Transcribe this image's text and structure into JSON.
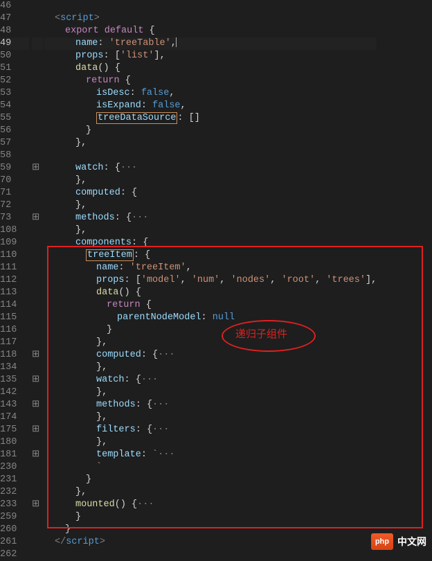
{
  "annotation": {
    "label": "递归子组件"
  },
  "watermark": {
    "badge": "php",
    "text": "中文网"
  },
  "lines": [
    {
      "n": "46",
      "f": "",
      "html": "<span class='ind'></span>"
    },
    {
      "n": "47",
      "f": "",
      "html": "<span class='ind'></span><span class='tag'>&lt;</span><span class='kw'>script</span><span class='tag'>&gt;</span>"
    },
    {
      "n": "48",
      "f": "",
      "html": "<span class='ind'></span><span class='ind'></span><span class='exp'>export</span> <span class='exp'>default</span> <span class='brc'>{</span>"
    },
    {
      "n": "49",
      "f": "",
      "cur": true,
      "html": "<span class='ind'></span><span class='ind'></span><span class='ind'></span><span class='prop'>name</span><span class='punc'>:</span> <span class='str'>'treeTable'</span><span class='punc'>,</span><span class='cursor-mark'></span>"
    },
    {
      "n": "50",
      "f": "",
      "html": "<span class='ind'></span><span class='ind'></span><span class='ind'></span><span class='prop'>props</span><span class='punc'>:</span> <span class='punc'>[</span><span class='str'>'list'</span><span class='punc'>]</span><span class='punc'>,</span>"
    },
    {
      "n": "51",
      "f": "",
      "html": "<span class='ind'></span><span class='ind'></span><span class='ind'></span><span class='fn'>data</span><span class='punc'>()</span> <span class='brc'>{</span>"
    },
    {
      "n": "52",
      "f": "",
      "html": "<span class='ind'></span><span class='ind'></span><span class='ind'></span><span class='ind'></span><span class='exp'>return</span> <span class='brc'>{</span>"
    },
    {
      "n": "53",
      "f": "",
      "html": "<span class='ind'></span><span class='ind'></span><span class='ind'></span><span class='ind'></span><span class='ind'></span><span class='prop'>isDesc</span><span class='punc'>:</span> <span class='bool'>false</span><span class='punc'>,</span>"
    },
    {
      "n": "54",
      "f": "",
      "html": "<span class='ind'></span><span class='ind'></span><span class='ind'></span><span class='ind'></span><span class='ind'></span><span class='prop'>isExpand</span><span class='punc'>:</span> <span class='bool'>false</span><span class='punc'>,</span>"
    },
    {
      "n": "55",
      "f": "",
      "html": "<span class='ind'></span><span class='ind'></span><span class='ind'></span><span class='ind'></span><span class='ind'></span><span class='underline-box'><span class='prop'>treeDataSource</span></span><span class='punc'>:</span> <span class='punc'>[]</span>"
    },
    {
      "n": "56",
      "f": "",
      "html": "<span class='ind'></span><span class='ind'></span><span class='ind'></span><span class='ind'></span><span class='brc'>}</span>"
    },
    {
      "n": "57",
      "f": "",
      "html": "<span class='ind'></span><span class='ind'></span><span class='ind'></span><span class='brc'>}</span><span class='punc'>,</span>"
    },
    {
      "n": "58",
      "f": "",
      "html": "<span class='ind'></span>"
    },
    {
      "n": "59",
      "f": "⊞",
      "html": "<span class='ind'></span><span class='ind'></span><span class='ind'></span><span class='prop'>watch</span><span class='punc'>:</span> <span class='brc'>{</span><span class='ellips'>···</span>"
    },
    {
      "n": "70",
      "f": "",
      "html": "<span class='ind'></span><span class='ind'></span><span class='ind'></span><span class='brc'>}</span><span class='punc'>,</span>"
    },
    {
      "n": "71",
      "f": "",
      "html": "<span class='ind'></span><span class='ind'></span><span class='ind'></span><span class='prop'>computed</span><span class='punc'>:</span> <span class='brc'>{</span>"
    },
    {
      "n": "72",
      "f": "",
      "html": "<span class='ind'></span><span class='ind'></span><span class='ind'></span><span class='brc'>}</span><span class='punc'>,</span>"
    },
    {
      "n": "73",
      "f": "⊞",
      "html": "<span class='ind'></span><span class='ind'></span><span class='ind'></span><span class='prop'>methods</span><span class='punc'>:</span> <span class='brc'>{</span><span class='ellips'>···</span>"
    },
    {
      "n": "108",
      "f": "",
      "html": "<span class='ind'></span><span class='ind'></span><span class='ind'></span><span class='brc'>}</span><span class='punc'>,</span>"
    },
    {
      "n": "109",
      "f": "",
      "html": "<span class='ind'></span><span class='ind'></span><span class='ind'></span><span class='prop'>components</span><span class='punc'>:</span> <span class='brc'>{</span>"
    },
    {
      "n": "110",
      "f": "",
      "html": "<span class='ind'></span><span class='ind'></span><span class='ind'></span><span class='ind'></span><span class='underline-box'><span class='prop'>treeItem</span></span><span class='punc'>:</span> <span class='brc'>{</span>"
    },
    {
      "n": "111",
      "f": "",
      "html": "<span class='ind'></span><span class='ind'></span><span class='ind'></span><span class='ind'></span><span class='ind'></span><span class='prop'>name</span><span class='punc'>:</span> <span class='str'>'treeItem'</span><span class='punc'>,</span>"
    },
    {
      "n": "112",
      "f": "",
      "html": "<span class='ind'></span><span class='ind'></span><span class='ind'></span><span class='ind'></span><span class='ind'></span><span class='prop'>props</span><span class='punc'>:</span> <span class='punc'>[</span><span class='str'>'model'</span><span class='punc'>,</span> <span class='str'>'num'</span><span class='punc'>,</span> <span class='str'>'nodes'</span><span class='punc'>,</span> <span class='str'>'root'</span><span class='punc'>,</span> <span class='str'>'trees'</span><span class='punc'>]</span><span class='punc'>,</span>"
    },
    {
      "n": "113",
      "f": "",
      "html": "<span class='ind'></span><span class='ind'></span><span class='ind'></span><span class='ind'></span><span class='ind'></span><span class='fn'>data</span><span class='punc'>()</span> <span class='brc'>{</span>"
    },
    {
      "n": "114",
      "f": "",
      "html": "<span class='ind'></span><span class='ind'></span><span class='ind'></span><span class='ind'></span><span class='ind'></span><span class='ind'></span><span class='exp'>return</span> <span class='brc'>{</span>"
    },
    {
      "n": "115",
      "f": "",
      "html": "<span class='ind'></span><span class='ind'></span><span class='ind'></span><span class='ind'></span><span class='ind'></span><span class='ind'></span><span class='ind'></span><span class='prop'>parentNodeModel</span><span class='punc'>:</span> <span class='bool'>null</span>"
    },
    {
      "n": "116",
      "f": "",
      "html": "<span class='ind'></span><span class='ind'></span><span class='ind'></span><span class='ind'></span><span class='ind'></span><span class='ind'></span><span class='brc'>}</span>"
    },
    {
      "n": "117",
      "f": "",
      "html": "<span class='ind'></span><span class='ind'></span><span class='ind'></span><span class='ind'></span><span class='ind'></span><span class='brc'>}</span><span class='punc'>,</span>"
    },
    {
      "n": "118",
      "f": "⊞",
      "html": "<span class='ind'></span><span class='ind'></span><span class='ind'></span><span class='ind'></span><span class='ind'></span><span class='prop'>computed</span><span class='punc'>:</span> <span class='brc'>{</span><span class='ellips'>···</span>"
    },
    {
      "n": "134",
      "f": "",
      "html": "<span class='ind'></span><span class='ind'></span><span class='ind'></span><span class='ind'></span><span class='ind'></span><span class='brc'>}</span><span class='punc'>,</span>"
    },
    {
      "n": "135",
      "f": "⊞",
      "html": "<span class='ind'></span><span class='ind'></span><span class='ind'></span><span class='ind'></span><span class='ind'></span><span class='prop'>watch</span><span class='punc'>:</span> <span class='brc'>{</span><span class='ellips'>···</span>"
    },
    {
      "n": "142",
      "f": "",
      "html": "<span class='ind'></span><span class='ind'></span><span class='ind'></span><span class='ind'></span><span class='ind'></span><span class='brc'>}</span><span class='punc'>,</span>"
    },
    {
      "n": "143",
      "f": "⊞",
      "html": "<span class='ind'></span><span class='ind'></span><span class='ind'></span><span class='ind'></span><span class='ind'></span><span class='prop'>methods</span><span class='punc'>:</span> <span class='brc'>{</span><span class='ellips'>···</span>"
    },
    {
      "n": "174",
      "f": "",
      "html": "<span class='ind'></span><span class='ind'></span><span class='ind'></span><span class='ind'></span><span class='ind'></span><span class='brc'>}</span><span class='punc'>,</span>"
    },
    {
      "n": "175",
      "f": "⊞",
      "html": "<span class='ind'></span><span class='ind'></span><span class='ind'></span><span class='ind'></span><span class='ind'></span><span class='prop'>filters</span><span class='punc'>:</span> <span class='brc'>{</span><span class='ellips'>···</span>"
    },
    {
      "n": "180",
      "f": "",
      "html": "<span class='ind'></span><span class='ind'></span><span class='ind'></span><span class='ind'></span><span class='ind'></span><span class='brc'>}</span><span class='punc'>,</span>"
    },
    {
      "n": "181",
      "f": "⊞",
      "html": "<span class='ind'></span><span class='ind'></span><span class='ind'></span><span class='ind'></span><span class='ind'></span><span class='prop'>template</span><span class='punc'>:</span> <span class='str'>`</span><span class='ellips'>···</span>"
    },
    {
      "n": "230",
      "f": "",
      "html": "<span class='ind'></span><span class='ind'></span><span class='ind'></span><span class='ind'></span><span class='ind'></span><span class='str'>`</span>"
    },
    {
      "n": "231",
      "f": "",
      "html": "<span class='ind'></span><span class='ind'></span><span class='ind'></span><span class='ind'></span><span class='brc'>}</span>"
    },
    {
      "n": "232",
      "f": "",
      "html": "<span class='ind'></span><span class='ind'></span><span class='ind'></span><span class='brc'>}</span><span class='punc'>,</span>"
    },
    {
      "n": "233",
      "f": "⊞",
      "html": "<span class='ind'></span><span class='ind'></span><span class='ind'></span><span class='fn'>mounted</span><span class='punc'>()</span> <span class='brc'>{</span><span class='ellips'>···</span>"
    },
    {
      "n": "259",
      "f": "",
      "html": "<span class='ind'></span><span class='ind'></span><span class='ind'></span><span class='brc'>}</span>"
    },
    {
      "n": "260",
      "f": "",
      "html": "<span class='ind'></span><span class='ind'></span><span class='brc'>}</span>"
    },
    {
      "n": "261",
      "f": "",
      "html": "<span class='ind'></span><span class='tag'>&lt;/</span><span class='kw'>script</span><span class='tag'>&gt;</span>"
    },
    {
      "n": "262",
      "f": "",
      "html": ""
    }
  ]
}
